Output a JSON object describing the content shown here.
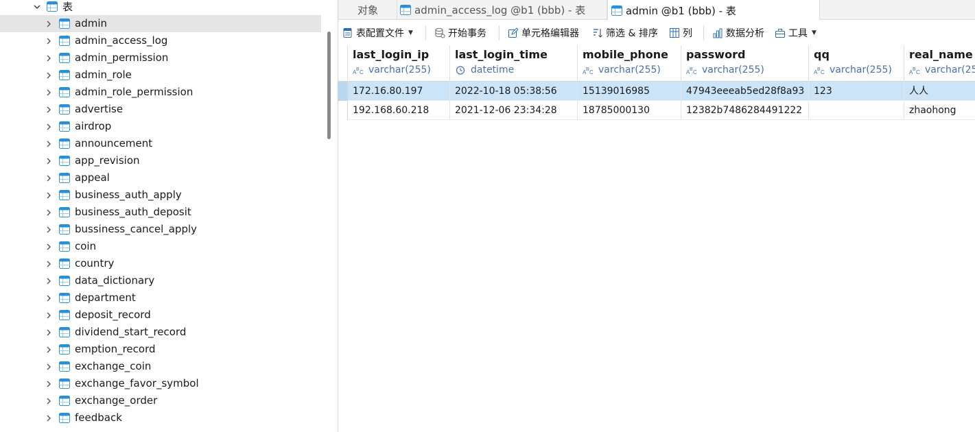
{
  "tree": {
    "group_label": "表",
    "selected_index": 0,
    "items": [
      "admin",
      "admin_access_log",
      "admin_permission",
      "admin_role",
      "admin_role_permission",
      "advertise",
      "airdrop",
      "announcement",
      "app_revision",
      "appeal",
      "business_auth_apply",
      "business_auth_deposit",
      "bussiness_cancel_apply",
      "coin",
      "country",
      "data_dictionary",
      "department",
      "deposit_record",
      "dividend_start_record",
      "emption_record",
      "exchange_coin",
      "exchange_favor_symbol",
      "exchange_order",
      "feedback"
    ]
  },
  "tabs": [
    {
      "label": "对象",
      "icon": "none",
      "active": false
    },
    {
      "label": "admin_access_log @b1 (bbb) - 表",
      "icon": "table-icon",
      "active": false
    },
    {
      "label": "admin @b1 (bbb) - 表",
      "icon": "table-icon",
      "active": true
    }
  ],
  "toolbar": {
    "table_config": "表配置文件",
    "begin_transaction": "开始事务",
    "cell_editor": "单元格编辑器",
    "filter_sort": "筛选 & 排序",
    "columns": "列",
    "data_analysis": "数据分析",
    "tools": "工具"
  },
  "grid": {
    "columns": [
      {
        "name": "last_login_ip",
        "type": "varchar(255)",
        "type_icon": "text-type-icon"
      },
      {
        "name": "last_login_time",
        "type": "datetime",
        "type_icon": "clock-type-icon"
      },
      {
        "name": "mobile_phone",
        "type": "varchar(255)",
        "type_icon": "text-type-icon"
      },
      {
        "name": "password",
        "type": "varchar(255)",
        "type_icon": "text-type-icon"
      },
      {
        "name": "qq",
        "type": "varchar(255)",
        "type_icon": "text-type-icon"
      },
      {
        "name": "real_name",
        "type": "varchar(25",
        "type_icon": "text-type-icon"
      }
    ],
    "rows": [
      [
        "172.16.80.197",
        "2022-10-18 05:38:56",
        "15139016985",
        "47943eeeab5ed28f8a93",
        "123",
        "人人"
      ],
      [
        "192.168.60.218",
        "2021-12-06 23:34:28",
        "18785000130",
        "12382b7486284491222",
        "",
        "zhaohong"
      ]
    ],
    "selected_row": 0
  },
  "colors": {
    "selected_tree_bg": "#e5e5e5",
    "selected_row_bg": "#cce4f7",
    "type_text": "#4a6fa5",
    "table_icon": "#2a8fd9"
  }
}
